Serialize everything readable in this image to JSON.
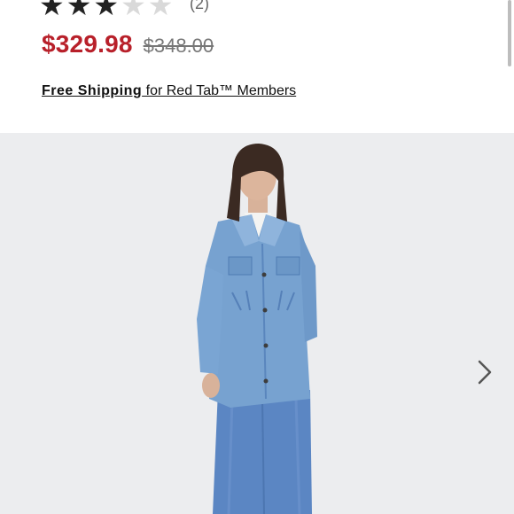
{
  "product": {
    "rating_count": "(2)",
    "rating_stars": 3,
    "rating_max": 5,
    "sale_price": "$329.98",
    "original_price": "$348.00"
  },
  "shipping": {
    "bold_text": "Free Shipping",
    "rest_text": " for Red Tab™ Members"
  },
  "gallery": {
    "image_alt_icon": "denim-jacket-model-photo",
    "next_icon": "chevron-right-icon"
  },
  "colors": {
    "sale_price": "#b8202a",
    "background_photo": "#ecedef",
    "denim": "#6f9ccb"
  }
}
